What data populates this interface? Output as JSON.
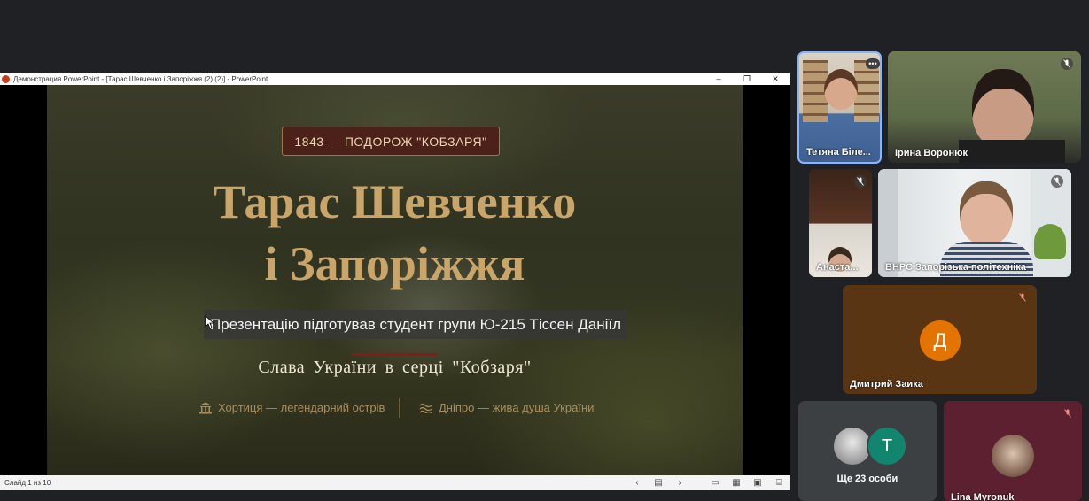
{
  "window": {
    "title": "Демонстрация PowerPoint - [Тарас Шевченко і Запоріжжя (2) (2)] - PowerPoint",
    "controls": [
      "–",
      "❐",
      "✕"
    ]
  },
  "slide": {
    "badge": "1843 — ПОДОРОЖ \"КОБЗАРЯ\"",
    "title_line1": "Тарас Шевченко",
    "title_line2": "і Запоріжжя",
    "author": "Презентацію підготував студент групи Ю-215 Тіссен Даніїл",
    "subtitle": "Слава України в серці \"Кобзаря\"",
    "feature_1": "Хортиця — легендарний острів",
    "feature_2": "Дніпро — жива душа України"
  },
  "statusbar": {
    "slide_counter": "Слайд 1 из 10"
  },
  "participants": [
    {
      "name": "Тетяна Біле..."
    },
    {
      "name": "Ірина Воронюк"
    },
    {
      "name": "Анаста..."
    },
    {
      "name": "ВНРС Запорізька політехніка"
    },
    {
      "name": "Дмитрий Заика",
      "initial": "Д",
      "color": "#e37400"
    },
    {
      "name": "Ще 23 особи",
      "initial": "Т"
    },
    {
      "name": "Lina Myronuk"
    }
  ],
  "colors": {
    "background": "#202124",
    "title_gold": "#c9a56a",
    "badge_bg": "#4b2119"
  }
}
